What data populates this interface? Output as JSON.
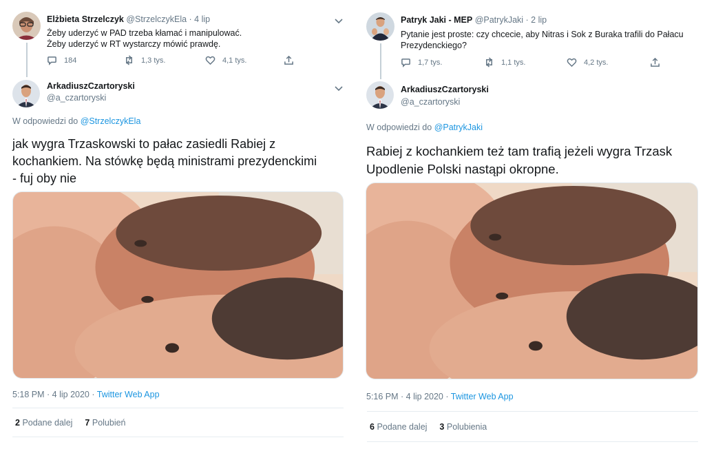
{
  "left": {
    "parent": {
      "name": "Elżbieta Strzelczyk",
      "handle": "@StrzelczykEla",
      "separator": " · ",
      "date": "4 lip",
      "lines": [
        "Żeby uderzyć w PAD trzeba kłamać i manipulować.",
        "Żeby uderzyć w RT wystarczy mówić prawdę."
      ],
      "replies": "184",
      "retweets": "1,3 tys.",
      "likes": "4,1 tys."
    },
    "reply": {
      "name": "ArkadiuszCzartoryski",
      "handle": "@a_czartoryski",
      "replying_prefix": "W odpowiedzi do",
      "replying_to": "@StrzelczykEla",
      "lines": [
        "jak wygra Trzaskowski to pałac zasiedli Rabiej z",
        "kochankiem. Na stówkę będą ministrami prezydenckimi",
        "- fuj oby nie"
      ],
      "time": "5:18 PM · 4 lip 2020 · ",
      "source": "Twitter Web App",
      "retweet_count": "2",
      "retweet_label": "Podane dalej",
      "like_count": "7",
      "like_label": "Polubień"
    }
  },
  "right": {
    "parent": {
      "name": "Patryk Jaki - MEP",
      "handle": "@PatrykJaki",
      "separator": " · ",
      "date": "2 lip",
      "lines": [
        "Pytanie jest proste: czy chcecie, aby Nitras i Sok z Buraka trafili do Pałacu",
        "Prezydenckiego?"
      ],
      "replies": "1,7 tys.",
      "retweets": "1,1 tys.",
      "likes": "4,2 tys."
    },
    "reply": {
      "name": "ArkadiuszCzartoryski",
      "handle": "@a_czartoryski",
      "replying_prefix": "W odpowiedzi do",
      "replying_to": "@PatrykJaki",
      "lines": [
        "Rabiej z kochankiem też tam trafią jeżeli wygra Trzask",
        "Upodlenie Polski nastąpi okropne."
      ],
      "time": "5:16 PM · 4 lip 2020 · ",
      "source": "Twitter Web App",
      "retweet_count": "6",
      "retweet_label": "Podane dalej",
      "like_count": "3",
      "like_label": "Polubienia"
    }
  },
  "icons": [
    "reply-icon",
    "retweet-icon",
    "like-icon",
    "share-icon",
    "chevron-down-icon"
  ],
  "colors": {
    "link": "#1b95e0",
    "secondary": "#657786",
    "text": "#14171a",
    "thread_line": "#c4cfd6"
  }
}
